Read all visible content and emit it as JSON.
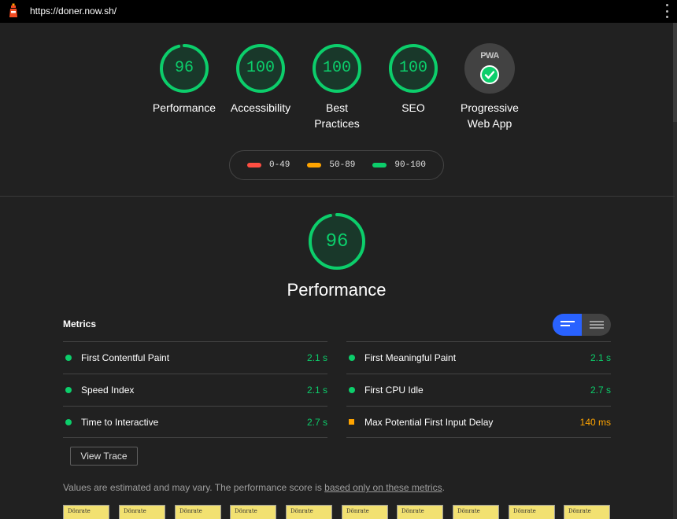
{
  "header": {
    "url": "https://doner.now.sh/"
  },
  "summary_gauges": [
    {
      "score": "96",
      "label": "Performance",
      "value": 0.96
    },
    {
      "score": "100",
      "label": "Accessibility",
      "value": 1.0
    },
    {
      "score": "100",
      "label": "Best Practices",
      "value": 1.0
    },
    {
      "score": "100",
      "label": "SEO",
      "value": 1.0
    }
  ],
  "pwa": {
    "badge_text": "PWA",
    "label": "Progressive Web App"
  },
  "legend": [
    {
      "range": "0-49",
      "color": "#ff4e42"
    },
    {
      "range": "50-89",
      "color": "#ffa400"
    },
    {
      "range": "90-100",
      "color": "#0cce6b"
    }
  ],
  "performance": {
    "score": "96",
    "value": 0.96,
    "title": "Performance"
  },
  "metrics": {
    "title": "Metrics",
    "left": [
      {
        "label": "First Contentful Paint",
        "value": "2.1 s",
        "status": "pass"
      },
      {
        "label": "Speed Index",
        "value": "2.1 s",
        "status": "pass"
      },
      {
        "label": "Time to Interactive",
        "value": "2.7 s",
        "status": "pass"
      }
    ],
    "right": [
      {
        "label": "First Meaningful Paint",
        "value": "2.1 s",
        "status": "pass"
      },
      {
        "label": "First CPU Idle",
        "value": "2.7 s",
        "status": "pass"
      },
      {
        "label": "Max Potential First Input Delay",
        "value": "140 ms",
        "status": "average"
      }
    ]
  },
  "view_trace_label": "View Trace",
  "note": {
    "text": "Values are estimated and may vary. The performance score is ",
    "link": "based only on these metrics",
    "suffix": "."
  },
  "filmstrip_frames": [
    "Dönrate",
    "Dönrate",
    "Dönrate",
    "Dönrate",
    "Dönrate",
    "Dönrate",
    "Dönrate",
    "Dönrate",
    "Dönrate",
    "Dönrate"
  ],
  "colors": {
    "pass": "#0cce6b",
    "average": "#ffa400",
    "fail": "#ff4e42",
    "toggle_active": "#2962ff"
  }
}
